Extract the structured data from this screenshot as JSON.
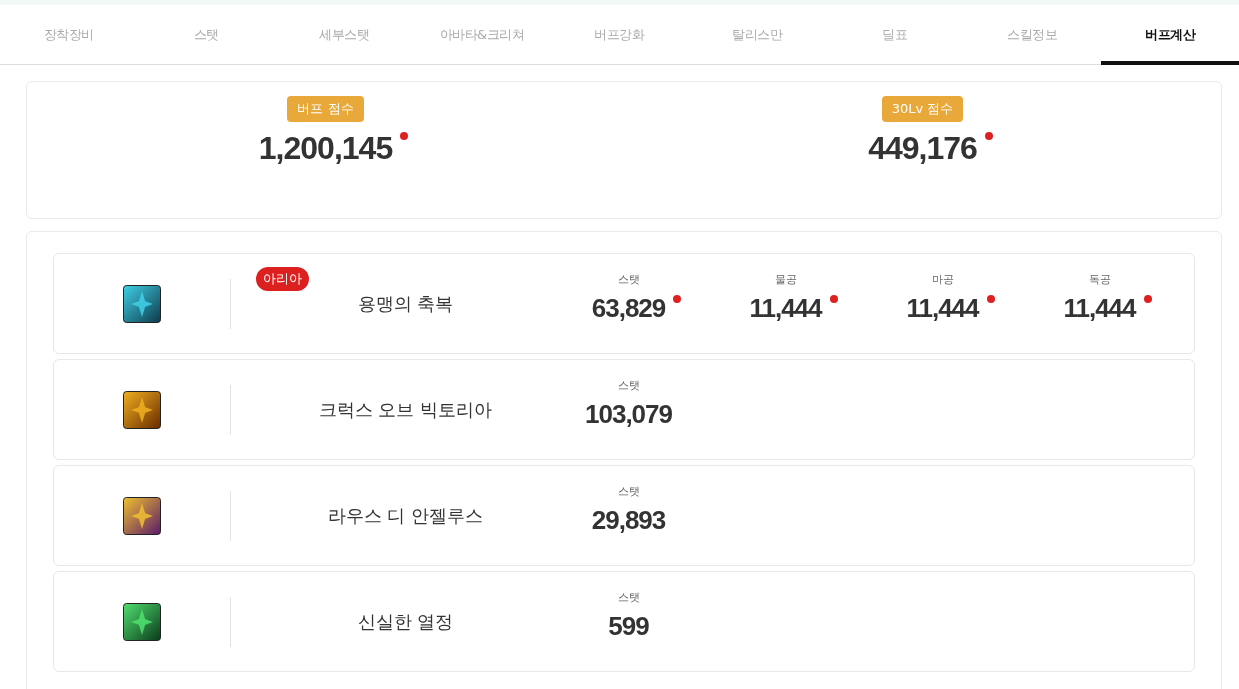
{
  "tabs": [
    {
      "label": "장착장비",
      "selected": false
    },
    {
      "label": "스탯",
      "selected": false
    },
    {
      "label": "세부스탯",
      "selected": false
    },
    {
      "label": "아바타&크리쳐",
      "selected": false
    },
    {
      "label": "버프강화",
      "selected": false
    },
    {
      "label": "탈리스만",
      "selected": false
    },
    {
      "label": "딜표",
      "selected": false
    },
    {
      "label": "스킬정보",
      "selected": false
    },
    {
      "label": "버프계산",
      "selected": true
    }
  ],
  "scores": [
    {
      "badge": "버프 점수",
      "value": "1,200,145",
      "flagged": true
    },
    {
      "badge": "30Lv 점수",
      "value": "449,176",
      "flagged": true
    }
  ],
  "buffs": [
    {
      "name": "용맹의 축복",
      "tag": "아리아",
      "stats": [
        {
          "label": "스탯",
          "value": "63,829",
          "flagged": true
        },
        {
          "label": "물공",
          "value": "11,444",
          "flagged": true
        },
        {
          "label": "마공",
          "value": "11,444",
          "flagged": true
        },
        {
          "label": "독공",
          "value": "11,444",
          "flagged": true
        }
      ]
    },
    {
      "name": "크럭스 오브 빅토리아",
      "stats": [
        {
          "label": "스탯",
          "value": "103,079",
          "flagged": false
        }
      ]
    },
    {
      "name": "라우스 디 안젤루스",
      "stats": [
        {
          "label": "스탯",
          "value": "29,893",
          "flagged": false
        }
      ]
    },
    {
      "name": "신실한 열정",
      "stats": [
        {
          "label": "스탯",
          "value": "599",
          "flagged": false
        }
      ]
    }
  ]
}
